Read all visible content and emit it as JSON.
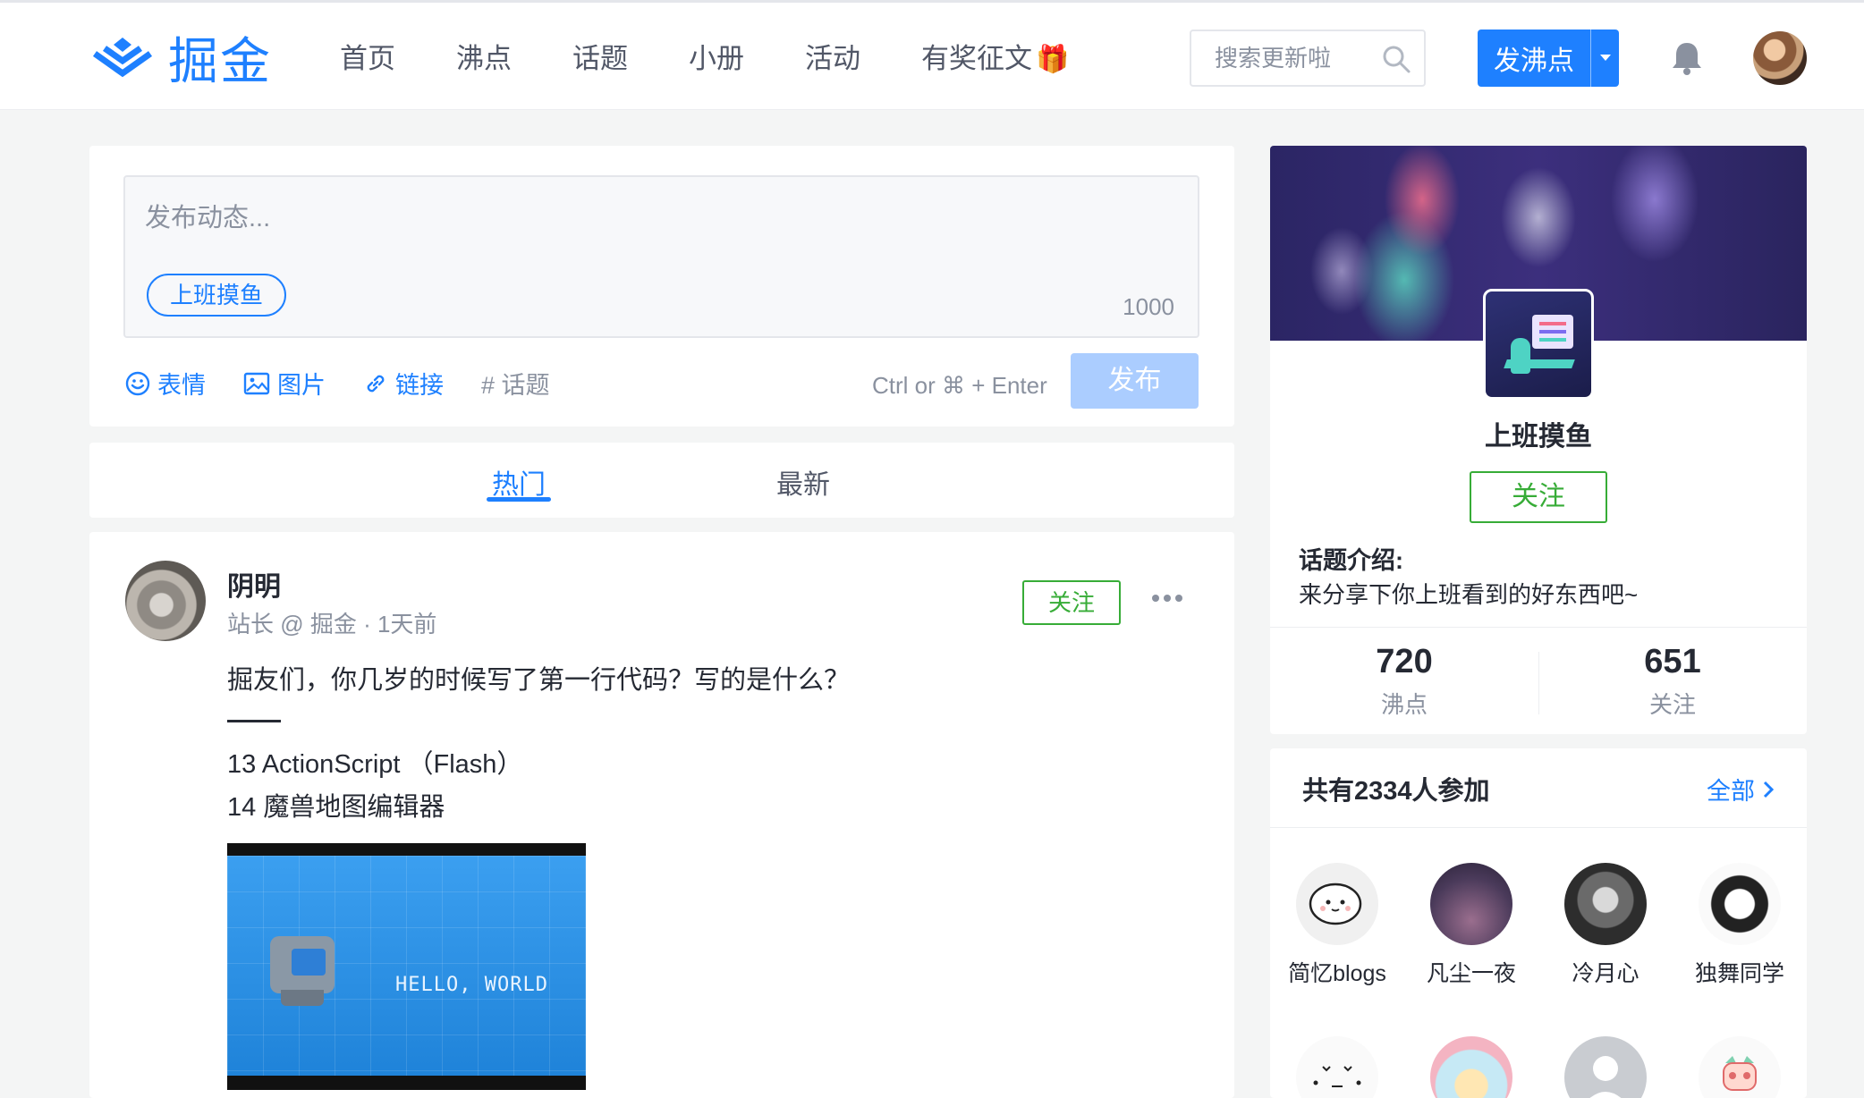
{
  "header": {
    "logo_text": "掘金",
    "nav": [
      "首页",
      "沸点",
      "话题",
      "小册",
      "活动",
      "有奖征文"
    ],
    "nav_badge_icon": "gift-icon",
    "search_placeholder": "搜索更新啦",
    "post_button": "发沸点"
  },
  "composer": {
    "placeholder": "发布动态...",
    "topic_tag": "上班摸鱼",
    "char_count": "1000",
    "tools": {
      "emoji": "表情",
      "image": "图片",
      "link": "链接",
      "topic": "# 话题"
    },
    "shortcut_hint": "Ctrl or ⌘ + Enter",
    "submit": "发布"
  },
  "tabs": {
    "hot": "热门",
    "latest": "最新"
  },
  "post": {
    "author": "阴明",
    "meta": "站长 @ 掘金 · 1天前",
    "follow": "关注",
    "content": "掘友们，你几岁的时候写了第一行代码？写的是什么？",
    "line2": "13 ActionScript （Flash）",
    "line3": "14 魔兽地图编辑器",
    "image_text": "HELLO, WORLD"
  },
  "topic": {
    "name": "上班摸鱼",
    "follow": "关注",
    "intro_title": "话题介绍:",
    "intro_text": "来分享下你上班看到的好东西吧~",
    "stats": [
      {
        "num": "720",
        "label": "沸点"
      },
      {
        "num": "651",
        "label": "关注"
      }
    ]
  },
  "participants": {
    "title": "共有2334人参加",
    "all": "全部",
    "members": [
      {
        "name": "简忆blogs"
      },
      {
        "name": "凡尘一夜"
      },
      {
        "name": "冷月心"
      },
      {
        "name": "独舞同学"
      },
      {
        "name": ""
      },
      {
        "name": ""
      },
      {
        "name": ""
      },
      {
        "name": ""
      }
    ]
  },
  "colors": {
    "brand": "#1e80ff",
    "follow": "#37ac37",
    "page_bg": "#f4f5f5"
  }
}
